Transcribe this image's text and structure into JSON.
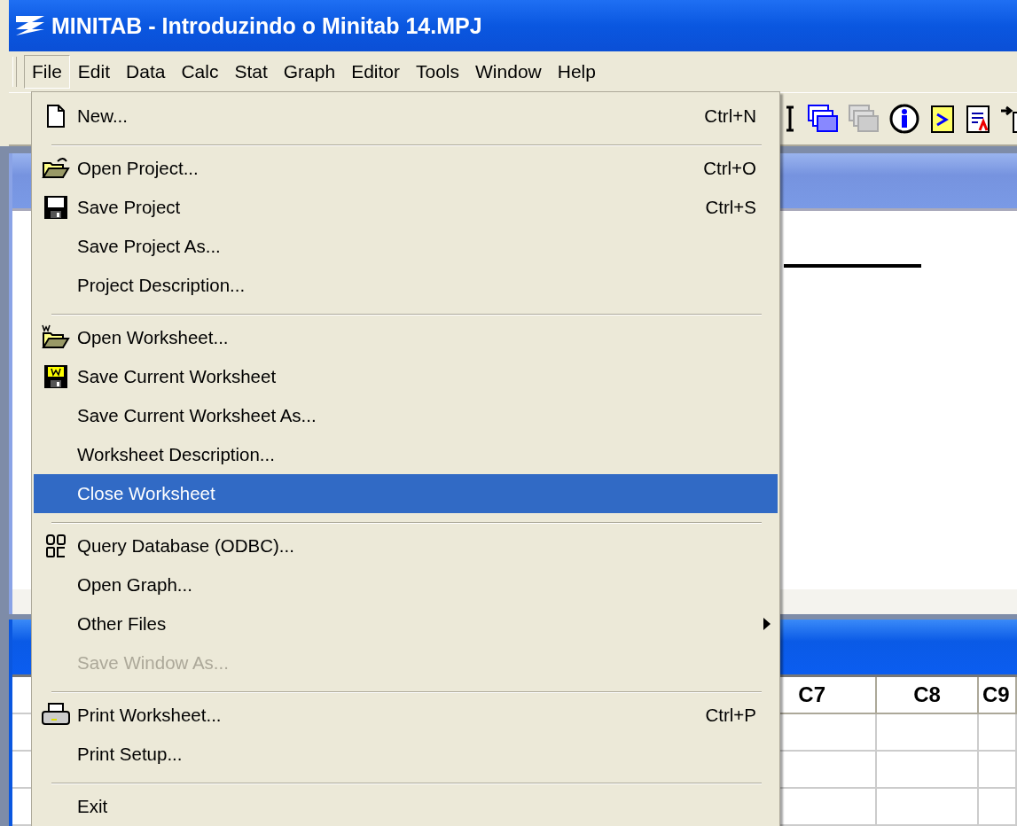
{
  "window": {
    "title": "MINITAB - Introduzindo o Minitab 14.MPJ"
  },
  "menubar": [
    {
      "label": "File",
      "selected": true
    },
    {
      "label": "Edit",
      "selected": false
    },
    {
      "label": "Data",
      "selected": false
    },
    {
      "label": "Calc",
      "selected": false
    },
    {
      "label": "Stat",
      "selected": false
    },
    {
      "label": "Graph",
      "selected": false
    },
    {
      "label": "Editor",
      "selected": false
    },
    {
      "label": "Tools",
      "selected": false
    },
    {
      "label": "Window",
      "selected": false
    },
    {
      "label": "Help",
      "selected": false
    }
  ],
  "file_menu": [
    {
      "kind": "item",
      "label": "New...",
      "shortcut": "Ctrl+N",
      "selected": false,
      "disabled": false,
      "submenu": false
    },
    {
      "kind": "separator"
    },
    {
      "kind": "item",
      "label": "Open Project...",
      "shortcut": "Ctrl+O",
      "selected": false,
      "disabled": false,
      "submenu": false
    },
    {
      "kind": "item",
      "label": "Save Project",
      "shortcut": "Ctrl+S",
      "selected": false,
      "disabled": false,
      "submenu": false
    },
    {
      "kind": "item",
      "label": "Save Project As...",
      "selected": false,
      "disabled": false,
      "submenu": false
    },
    {
      "kind": "item",
      "label": "Project Description...",
      "selected": false,
      "disabled": false,
      "submenu": false
    },
    {
      "kind": "separator"
    },
    {
      "kind": "item",
      "label": "Open Worksheet...",
      "selected": false,
      "disabled": false,
      "submenu": false
    },
    {
      "kind": "item",
      "label": "Save Current Worksheet",
      "selected": false,
      "disabled": false,
      "submenu": false
    },
    {
      "kind": "item",
      "label": "Save Current Worksheet As...",
      "selected": false,
      "disabled": false,
      "submenu": false
    },
    {
      "kind": "item",
      "label": "Worksheet Description...",
      "selected": false,
      "disabled": false,
      "submenu": false
    },
    {
      "kind": "item",
      "label": "Close Worksheet",
      "selected": true,
      "disabled": false,
      "submenu": false
    },
    {
      "kind": "separator"
    },
    {
      "kind": "item",
      "label": "Query Database (ODBC)...",
      "selected": false,
      "disabled": false,
      "submenu": false
    },
    {
      "kind": "item",
      "label": "Open Graph...",
      "selected": false,
      "disabled": false,
      "submenu": false
    },
    {
      "kind": "item",
      "label": "Other Files",
      "selected": false,
      "disabled": false,
      "submenu": true
    },
    {
      "kind": "item",
      "label": "Save Window As...",
      "selected": false,
      "disabled": true,
      "submenu": false
    },
    {
      "kind": "separator"
    },
    {
      "kind": "item",
      "label": "Print Worksheet...",
      "shortcut": "Ctrl+P",
      "selected": false,
      "disabled": false,
      "submenu": false
    },
    {
      "kind": "item",
      "label": "Print Setup...",
      "selected": false,
      "disabled": false,
      "submenu": false
    },
    {
      "kind": "separator"
    },
    {
      "kind": "item",
      "label": "Exit",
      "selected": false,
      "disabled": false,
      "submenu": false
    }
  ],
  "worksheet": {
    "columns": [
      "C7",
      "C8",
      "C9"
    ]
  }
}
